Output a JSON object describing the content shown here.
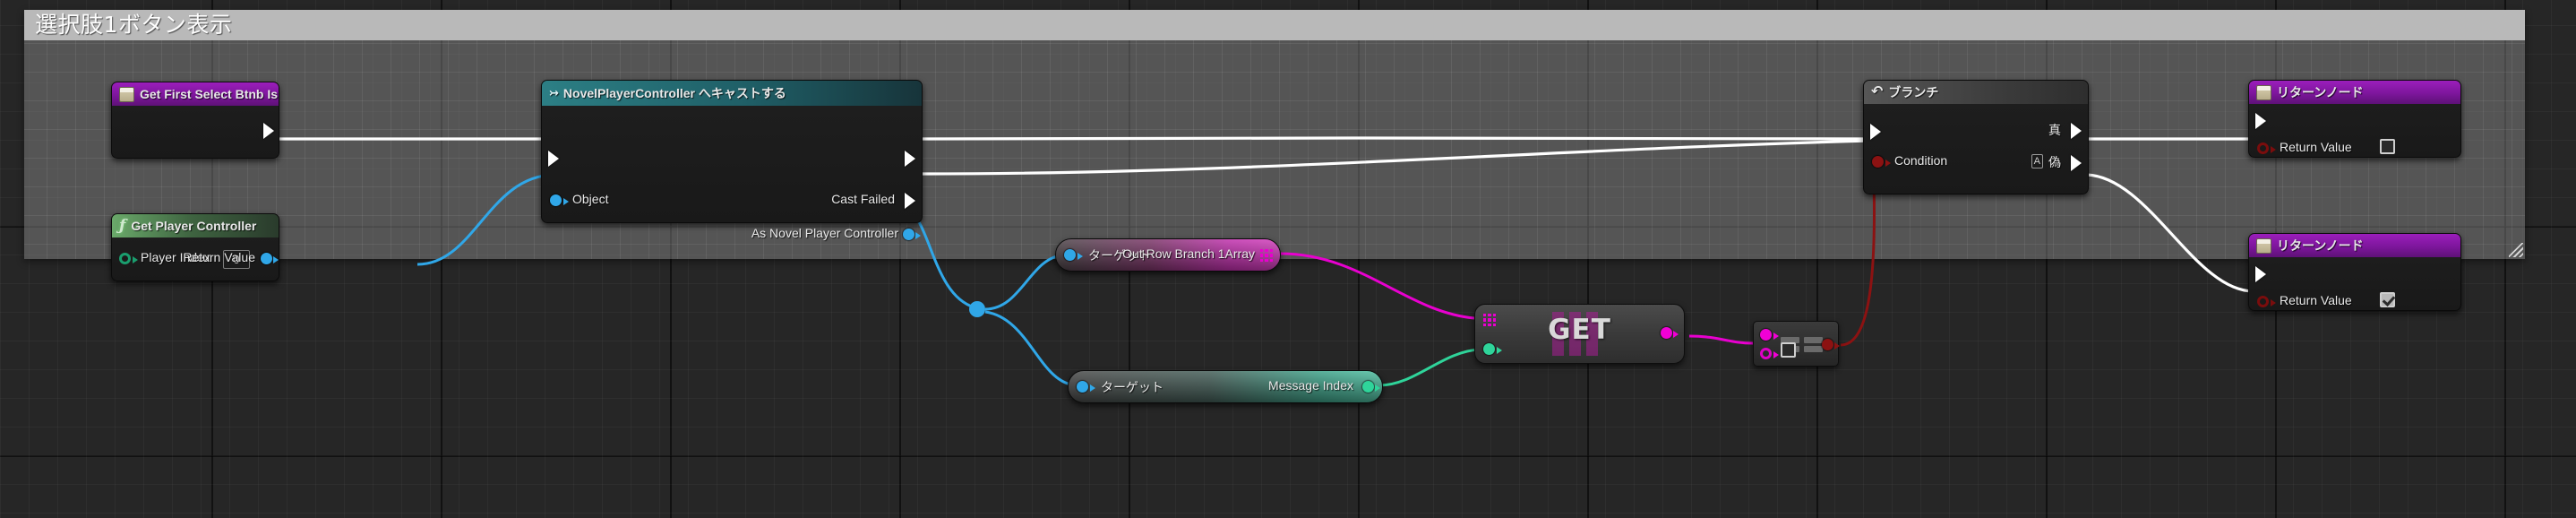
{
  "comment": {
    "title": "選択肢1ボタン表示",
    "resize_handle": "resize-handle"
  },
  "nodes": {
    "get_first_select": {
      "title": "Get First Select Btnb Is Enabled",
      "icon": "variable-icon",
      "exec_out": "exec-out"
    },
    "get_player_controller": {
      "title": "Get Player Controller",
      "icon": "function-icon",
      "input_label": "Player Index",
      "input_value": "0",
      "output_label": "Return Value"
    },
    "cast": {
      "title": "NovelPlayerController へキャストする",
      "icon": "cast-icon",
      "input_object": "Object",
      "output_cast_failed": "Cast Failed",
      "output_as": "As Novel Player Controller"
    },
    "out_row_branch": {
      "target_label": "ターゲット",
      "output_label": "Out Row Branch 1Array",
      "output_kind": "array-pin"
    },
    "message_index": {
      "target_label": "ターゲット",
      "output_label": "Message Index",
      "output_kind": "int-pin"
    },
    "get_array": {
      "label": "GET",
      "input_array": "array-in-pin",
      "input_index": "index-in-pin",
      "output_item": "item-out-pin"
    },
    "compare": {
      "checkbox_checked": false,
      "input_a": "struct-pin-a",
      "input_b": "struct-pin-b",
      "output_bool": "bool-out-pin"
    },
    "branch": {
      "title": "ブランチ",
      "icon": "branch-icon",
      "condition_label": "Condition",
      "true_label": "真",
      "false_label": "偽",
      "false_badge": "A"
    },
    "return_top": {
      "title": "リターンノード",
      "icon": "variable-icon",
      "value_label": "Return Value",
      "value_checked": false
    },
    "return_bottom": {
      "title": "リターンノード",
      "icon": "variable-icon",
      "value_label": "Return Value",
      "value_checked": true
    }
  },
  "colors": {
    "exec_wire": "#ffffff",
    "object_wire": "#30a7e8",
    "struct_wire": "#e800cf",
    "int_wire": "#2fd49a",
    "bool_wire": "#8c1212",
    "title_purple": "#9b1ebb",
    "title_green": "#6aa96a",
    "title_cast": "#2c7f85",
    "comment_bar": "#b9b9b9"
  }
}
